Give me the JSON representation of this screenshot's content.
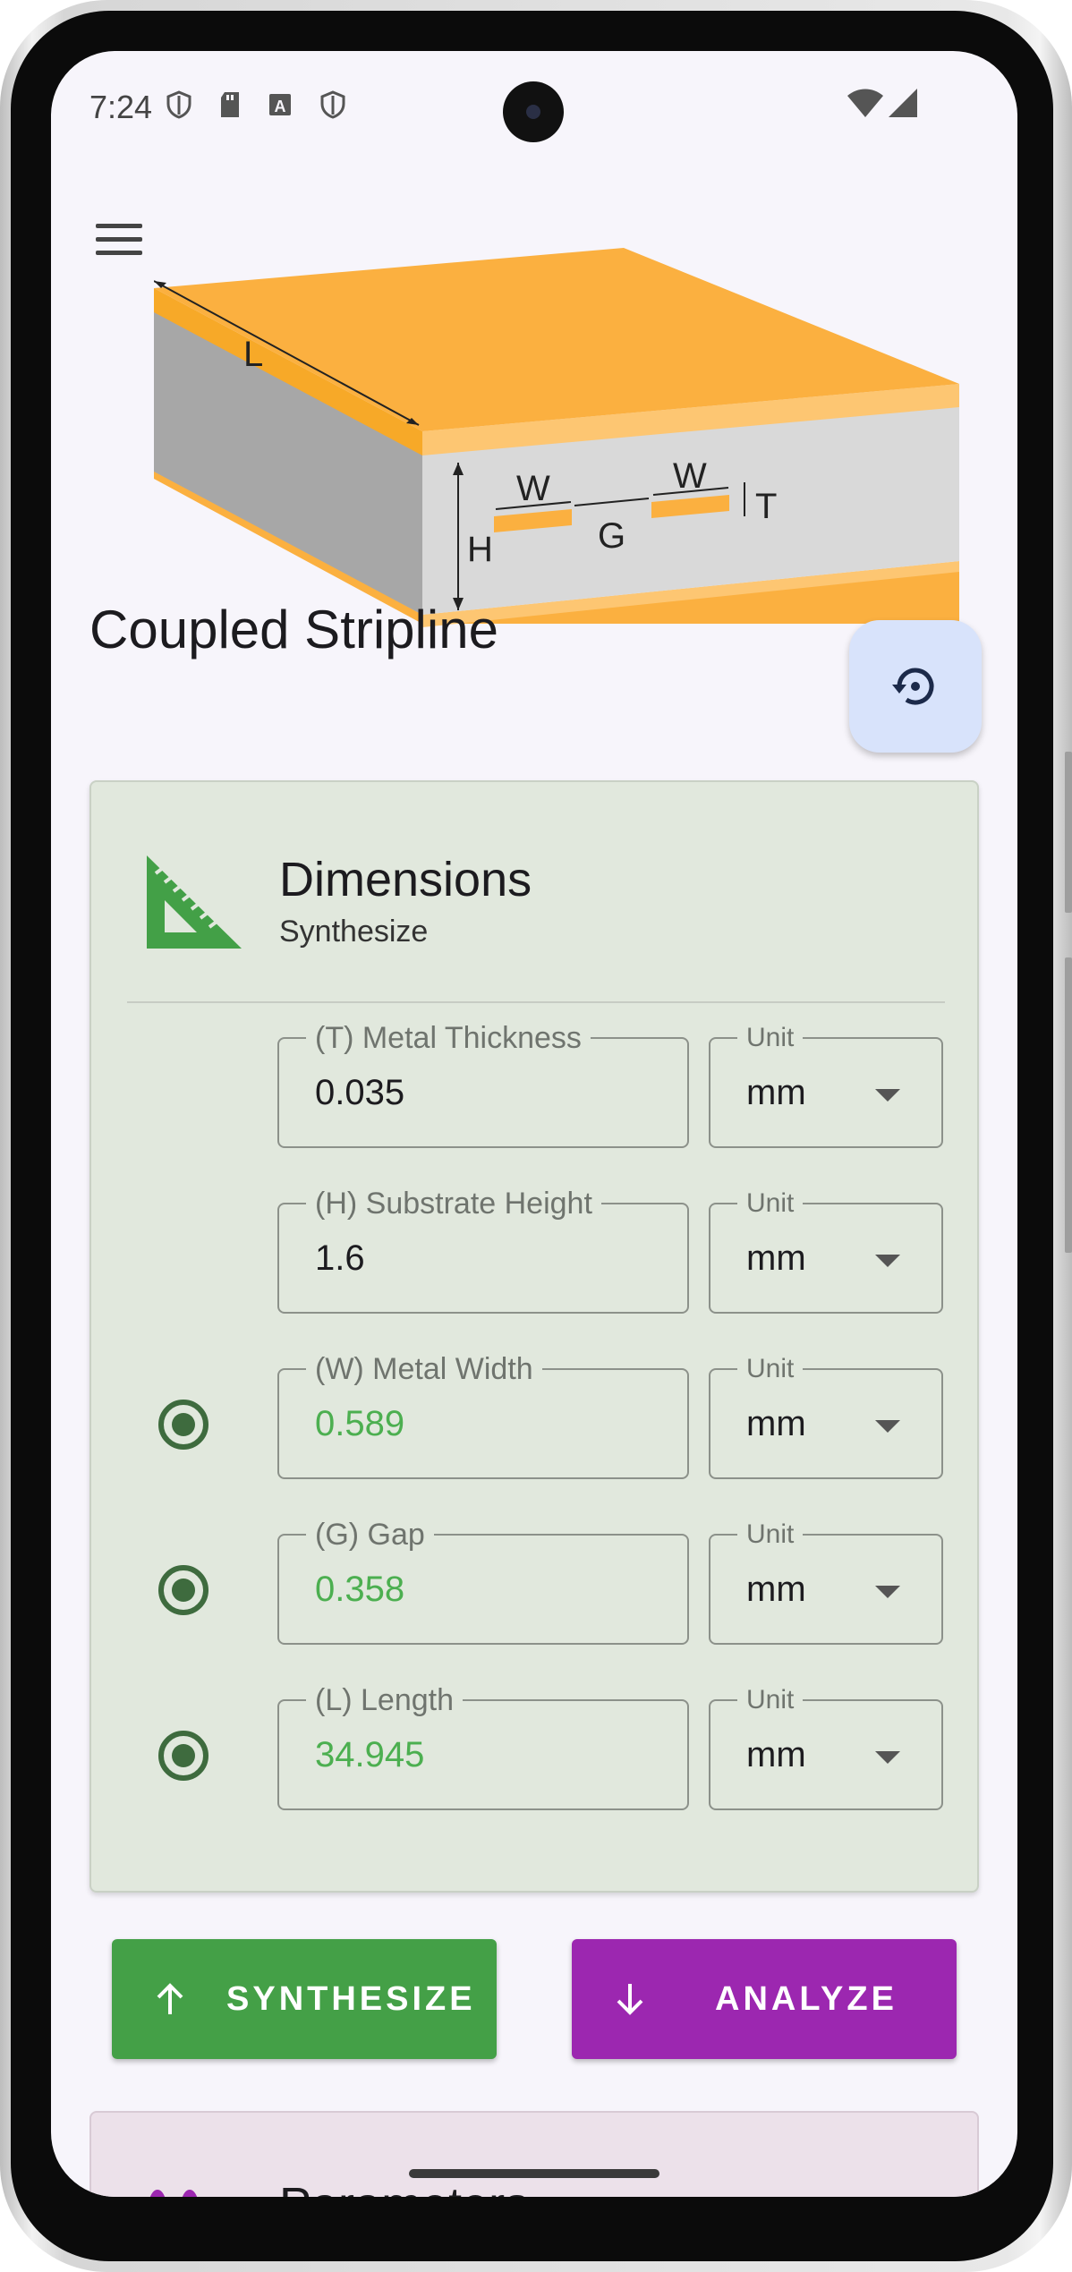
{
  "status_bar": {
    "time": "7:24",
    "left_icons": [
      "shield-icon",
      "sd-card-icon",
      "a-box-icon",
      "shield-icon"
    ],
    "right_icons": [
      "wifi-icon",
      "cell-signal-icon"
    ]
  },
  "header": {
    "menu_icon": "hamburger-menu-icon",
    "title": "Coupled Stripline"
  },
  "diagram": {
    "labels": {
      "L": "L",
      "W1": "W",
      "W2": "W",
      "G": "G",
      "H": "H",
      "T": "T"
    },
    "colors": {
      "metal": "#FBB040",
      "substrate": "#D9D9D9",
      "substrate_side": "#A7A7A7"
    }
  },
  "fab": {
    "icon": "restore-history-icon"
  },
  "dimensions": {
    "icon": "set-square-icon",
    "title": "Dimensions",
    "subtitle": "Synthesize",
    "fields": [
      {
        "label": "(T) Metal Thickness",
        "value": "0.035",
        "unit_label": "Unit",
        "unit": "mm",
        "radio": false,
        "result": false
      },
      {
        "label": "(H) Substrate Height",
        "value": "1.6",
        "unit_label": "Unit",
        "unit": "mm",
        "radio": false,
        "result": false
      },
      {
        "label": "(W) Metal Width",
        "value": "0.589",
        "unit_label": "Unit",
        "unit": "mm",
        "radio": true,
        "result": true
      },
      {
        "label": "(G) Gap",
        "value": "0.358",
        "unit_label": "Unit",
        "unit": "mm",
        "radio": true,
        "result": true
      },
      {
        "label": "(L) Length",
        "value": "34.945",
        "unit_label": "Unit",
        "unit": "mm",
        "radio": true,
        "result": true
      }
    ]
  },
  "actions": {
    "synthesize_label": "SYNTHESIZE",
    "analyze_label": "ANALYZE",
    "synthesize_color": "#43A047",
    "analyze_color": "#9C27B0"
  },
  "parameters": {
    "title": "Parameters"
  },
  "colors": {
    "background": "#F7F5FB",
    "card": "#E1E8DD",
    "result_text": "#4CAF50",
    "radio": "#3E6B3E"
  }
}
